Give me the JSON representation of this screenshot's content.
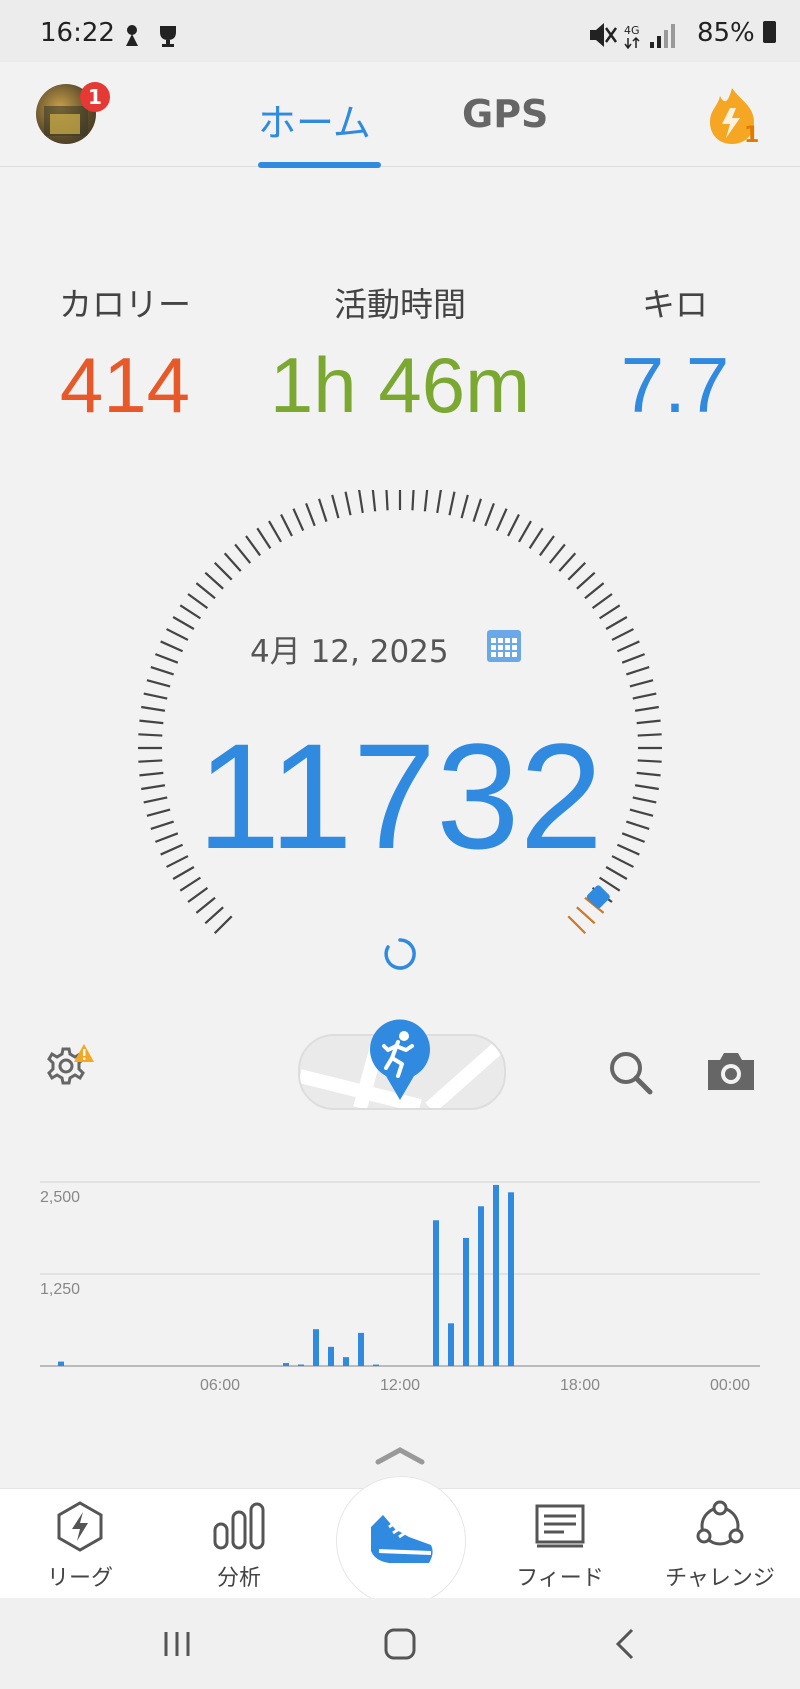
{
  "status_bar": {
    "time": "16:22",
    "network": "4G",
    "battery": "85%"
  },
  "header": {
    "notification_count": "1",
    "tabs": [
      {
        "label": "ホーム",
        "active": true
      },
      {
        "label": "GPS",
        "active": false
      }
    ],
    "streak_count": "1"
  },
  "stats": [
    {
      "label": "カロリー",
      "value": "414",
      "color": "#e8592a"
    },
    {
      "label": "活動時間",
      "value": "1h 46m",
      "color": "#7aa830"
    },
    {
      "label": "キロ",
      "value": "7.7",
      "color": "#2f8ae0"
    }
  ],
  "gauge": {
    "date": "4月 12, 2025",
    "steps": "11732",
    "progress": 0.97
  },
  "chart_data": {
    "type": "bar",
    "ytick_labels": [
      "2,500",
      "1,250"
    ],
    "xtick_labels": [
      "06:00",
      "12:00",
      "18:00",
      "00:00"
    ],
    "ylim": [
      0,
      2500
    ],
    "x_unit": "hour of day",
    "series": [
      {
        "points": [
          {
            "x": 0.7,
            "y": 60
          },
          {
            "x": 8.2,
            "y": 40
          },
          {
            "x": 8.7,
            "y": 20
          },
          {
            "x": 9.2,
            "y": 500
          },
          {
            "x": 9.7,
            "y": 260
          },
          {
            "x": 10.2,
            "y": 120
          },
          {
            "x": 10.7,
            "y": 450
          },
          {
            "x": 11.2,
            "y": 20
          },
          {
            "x": 13.2,
            "y": 1980
          },
          {
            "x": 13.7,
            "y": 580
          },
          {
            "x": 14.2,
            "y": 1740
          },
          {
            "x": 14.7,
            "y": 2170
          },
          {
            "x": 15.2,
            "y": 2460
          },
          {
            "x": 15.7,
            "y": 2360
          }
        ]
      }
    ]
  },
  "bottom_nav": [
    {
      "label": "リーグ",
      "icon": "league-bolt-icon"
    },
    {
      "label": "分析",
      "icon": "analytics-bars-icon"
    },
    {
      "label": "",
      "icon": "shoe-icon"
    },
    {
      "label": "フィード",
      "icon": "feed-icon"
    },
    {
      "label": "チャレンジ",
      "icon": "challenge-icon"
    }
  ],
  "colors": {
    "accent": "#2f8ae0",
    "calorie": "#e8592a",
    "active": "#7aa830",
    "warning": "#f5a623",
    "gauge_progress": "#c97a2a"
  }
}
